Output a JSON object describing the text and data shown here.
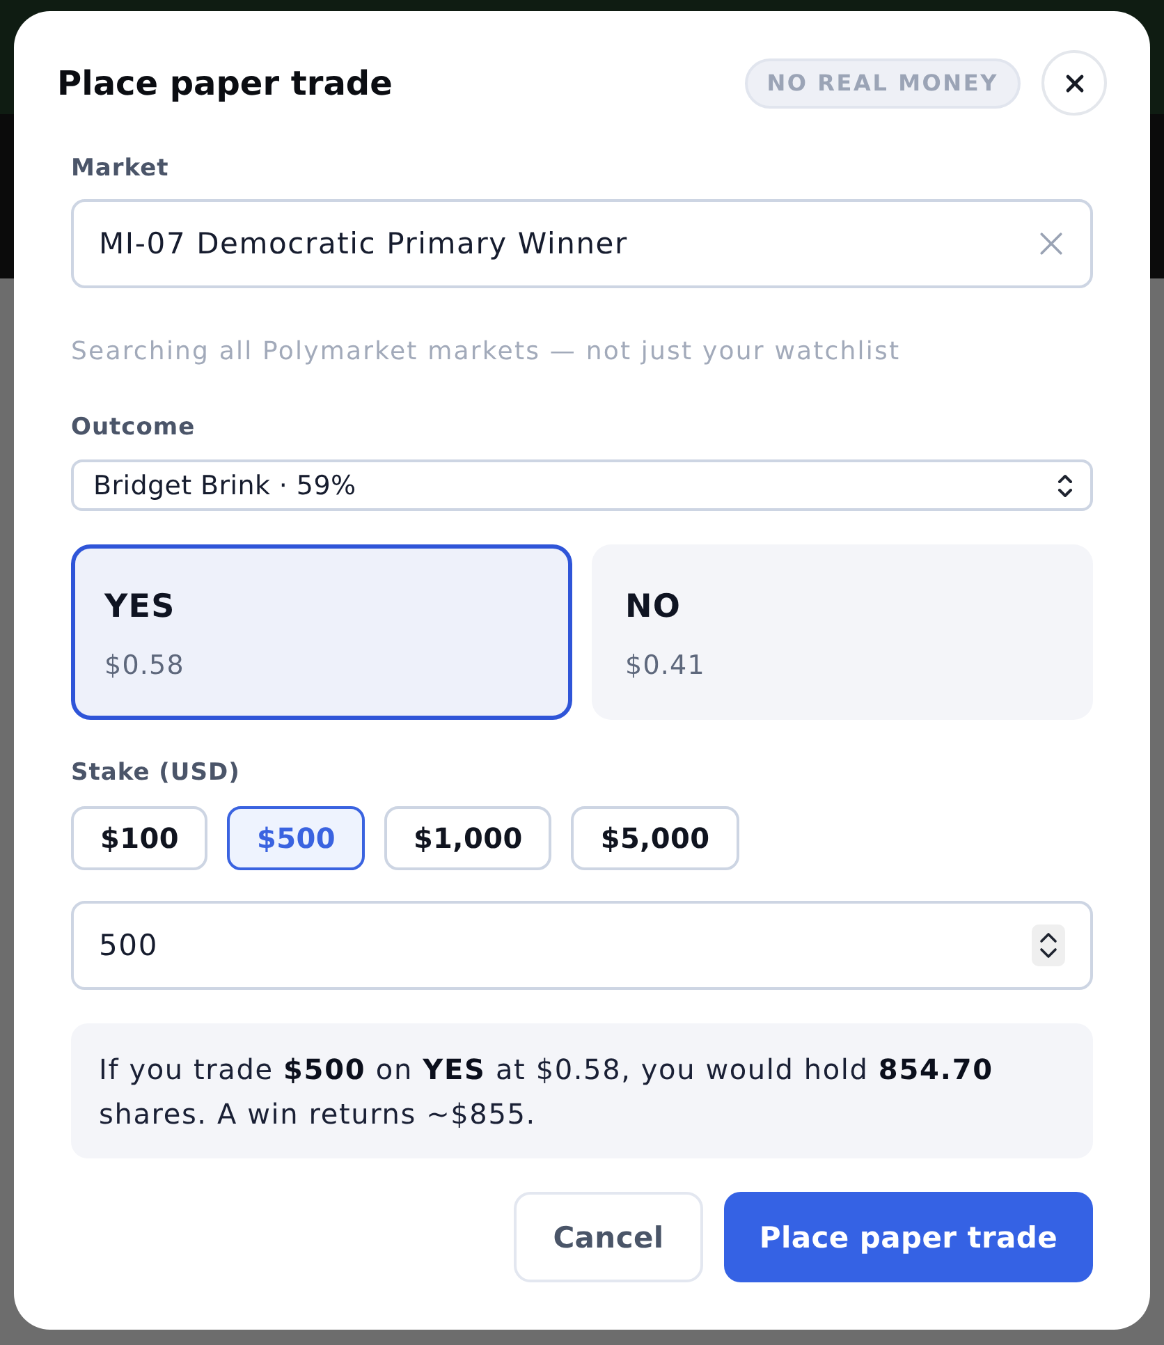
{
  "dialog": {
    "title": "Place paper trade",
    "badge": "NO REAL MONEY"
  },
  "market": {
    "label": "Market",
    "value": "MI-07 Democratic Primary Winner",
    "hint": "Searching all Polymarket markets — not just your watchlist"
  },
  "outcome": {
    "label": "Outcome",
    "value": "Bridget Brink · 59%"
  },
  "sides": [
    {
      "name": "YES",
      "price": "$0.58",
      "selected": true
    },
    {
      "name": "NO",
      "price": "$0.41",
      "selected": false
    }
  ],
  "stake": {
    "label": "Stake (USD)",
    "presets": [
      {
        "label": "$100",
        "selected": false
      },
      {
        "label": "$500",
        "selected": true
      },
      {
        "label": "$1,000",
        "selected": false
      },
      {
        "label": "$5,000",
        "selected": false
      }
    ],
    "value": "500"
  },
  "summary": "If you trade **$500** on **YES** at $0.58, you would hold **854.70** shares. A win returns ~$855.",
  "buttons": [
    {
      "label": "Cancel",
      "kind": "secondary"
    },
    {
      "label": "Place paper trade",
      "kind": "primary"
    }
  ]
}
